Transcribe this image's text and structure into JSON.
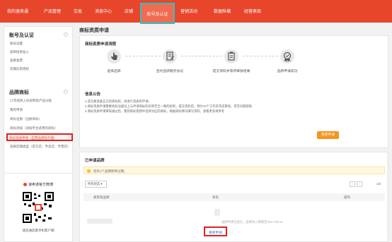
{
  "colors": {
    "brand": "#e8462b",
    "accent_border": "#29c4c9",
    "highlight_border": "#e02020",
    "apply_button": "#f7941d",
    "link": "#3a7bd5"
  },
  "nav": {
    "items": [
      "我的速卖通",
      "产品管理",
      "交易",
      "消息中心",
      "店铺",
      "账号及认证",
      "营销活动",
      "数据纵横",
      "经营表现"
    ],
    "active": "账号及认证"
  },
  "sidebar": {
    "account_title": "账号及认证",
    "account_items": [
      "账号设置",
      "类目招商准入",
      "查看发票",
      "店铺信息授权"
    ],
    "brand_title": "品牌商标",
    "brand_items": [
      "17年招商入驻说明及产品分级",
      "我的申请",
      "商标注册（注册商标）",
      "商标添加（添加平台适用的商标）"
    ],
    "brand_highlight": "商标资质申请（自营品牌及代理）",
    "brand_more": "选择店铺类型（官方店、专卖店、专营店）",
    "weibo": "速卖通官方微博",
    "qr_caption": "速卖通卖家手机客户端"
  },
  "main": {
    "page_title": "商标资质申请",
    "flow_title": "商标资质申请流程",
    "steps": [
      "选择品牌",
      "签约品牌服务协议",
      "提交资料并等待审核结果",
      "品牌申请成功"
    ],
    "info_title": "信息公告",
    "info_lines": [
      "1.首先要具备自己的商标权，再进行资质的申请；",
      "2.商标资质申请需要商标注册证上与申请商标的名称完全一致的权利，提交资料后，预计10个工作日完成审核，常见问题帮助",
      "3.商标资质申请审核通过后，需到商标管理中选择对应的商标，根据商标情况填写资料，查看更多请参考"
    ],
    "info_link": "常见问题帮助",
    "info_link2": "点击查看更多",
    "apply_label": "我要申请",
    "list_title": "已申请品牌",
    "warn_text": "您有1个品牌即将过期。",
    "status_filter": "所有状态",
    "pager": "1/3",
    "columns": [
      "类目及品牌",
      "状态",
      "操作"
    ],
    "row_status": "品牌申请已提交，品牌进入期限至2017-08-16",
    "review_label": "重新申请"
  }
}
